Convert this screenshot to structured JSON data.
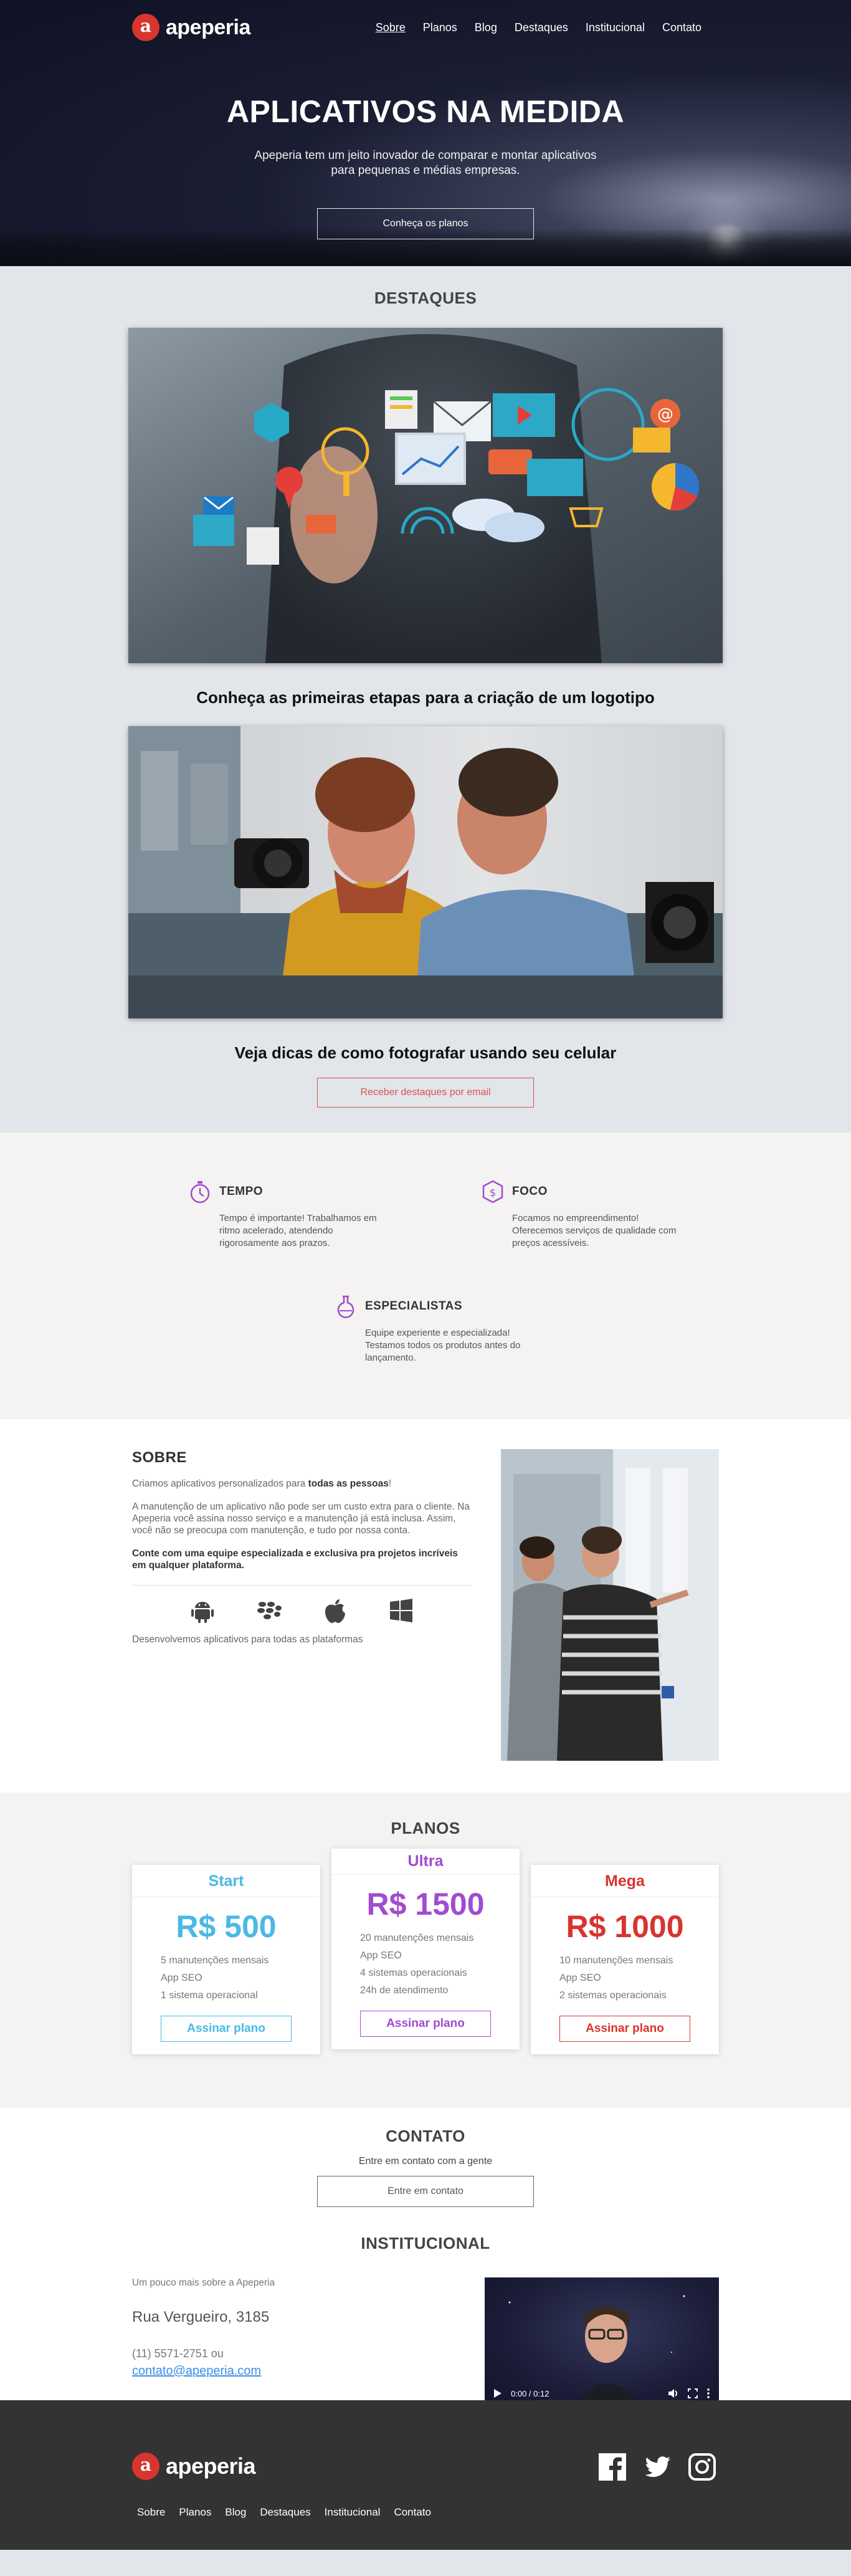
{
  "brand": {
    "name": "apeperia",
    "mark": "a"
  },
  "nav": {
    "items": [
      {
        "label": "Sobre",
        "active": true
      },
      {
        "label": "Planos"
      },
      {
        "label": "Blog"
      },
      {
        "label": "Destaques"
      },
      {
        "label": "Institucional"
      },
      {
        "label": "Contato"
      }
    ]
  },
  "hero": {
    "title": "APLICATIVOS NA MEDIDA",
    "subtitle": "Apeperia tem um jeito inovador de comparar e montar aplicativos para pequenas e médias empresas.",
    "cta": "Conheça os planos"
  },
  "destaques": {
    "title": "DESTAQUES",
    "items": [
      {
        "caption": "Conheça as primeiras etapas para a criação de um logotipo"
      },
      {
        "caption": "Veja dicas de como fotografar usando seu celular"
      }
    ],
    "cta": "Receber destaques por email"
  },
  "values": [
    {
      "title": "TEMPO",
      "icon": "stopwatch-icon",
      "text": "Tempo é importante! Trabalhamos em ritmo acelerado, atendendo rigorosamente aos prazos."
    },
    {
      "title": "FOCO",
      "icon": "dollar-shield-icon",
      "text": "Focamos no empreendimento! Oferecemos serviços de qualidade com preços acessíveis."
    },
    {
      "title": "ESPECIALISTAS",
      "icon": "flask-icon",
      "text": "Equipe experiente e especializada! Testamos todos os produtos antes do lançamento."
    }
  ],
  "sobre": {
    "title": "SOBRE",
    "p1_pre": "Criamos aplicativos personalizados para ",
    "p1_bold": "todas as pessoas",
    "p1_post": "!",
    "p2": "A manutenção de um aplicativo não pode ser um custo extra para o cliente. Na Apeperia você assina nosso serviço e a manutenção já está inclusa. Assim, você não se preocupa com manutenção, e tudo por nossa conta.",
    "p3": "Conte com uma equipe especializada e exclusiva pra projetos incríveis em qualquer plataforma.",
    "platforms": [
      "android-icon",
      "blackberry-icon",
      "apple-icon",
      "windows-icon"
    ],
    "footer": "Desenvolvemos aplicativos para todas as plataformas"
  },
  "planos": {
    "title": "PLANOS",
    "plans": [
      {
        "name": "Start",
        "price": "R$ 500",
        "color": "#4ab9e4",
        "features": [
          "5 manutenções mensais",
          "App SEO",
          "1 sistema operacional"
        ],
        "cta": "Assinar plano"
      },
      {
        "name": "Ultra",
        "price": "R$ 1500",
        "color": "#a24bd0",
        "features": [
          "20 manutenções mensais",
          "App SEO",
          "4 sistemas operacionais",
          "24h de atendimento"
        ],
        "cta": "Assinar plano"
      },
      {
        "name": "Mega",
        "price": "R$ 1000",
        "color": "#d8342f",
        "features": [
          "10 manutenções mensais",
          "App SEO",
          "2 sistemas operacionais"
        ],
        "cta": "Assinar plano"
      }
    ]
  },
  "contato": {
    "title": "CONTATO",
    "subtitle": "Entre em contato com a gente",
    "cta": "Entre em contato"
  },
  "institucional": {
    "title": "INSTITUCIONAL",
    "intro": "Um pouco mais sobre a Apeperia",
    "address": "Rua Vergueiro, 3185",
    "phone": "(11) 5571-2751 ou",
    "email": "contato@apeperia.com",
    "video_time": "0:00 / 0:12"
  },
  "footer": {
    "links": [
      "Sobre",
      "Planos",
      "Blog",
      "Destaques",
      "Institucional",
      "Contato"
    ],
    "social": [
      "facebook-icon",
      "twitter-icon",
      "instagram-icon"
    ]
  }
}
